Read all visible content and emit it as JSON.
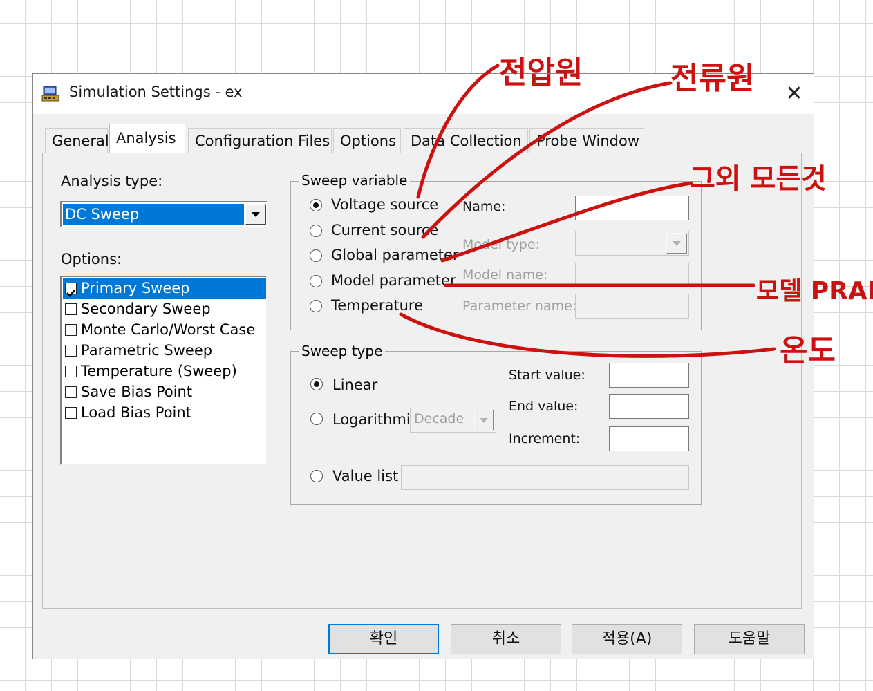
{
  "window": {
    "title": "Simulation Settings - ex",
    "close_glyph": "✕"
  },
  "tabs": [
    {
      "label": "General"
    },
    {
      "label": "Analysis",
      "active": true
    },
    {
      "label": "Configuration Files"
    },
    {
      "label": "Options"
    },
    {
      "label": "Data Collection"
    },
    {
      "label": "Probe Window"
    }
  ],
  "analysis": {
    "type_label": "Analysis type:",
    "type_value": "DC Sweep",
    "options_label": "Options:",
    "options": [
      {
        "label": "Primary Sweep",
        "checked": true,
        "selected": true
      },
      {
        "label": "Secondary Sweep",
        "checked": false
      },
      {
        "label": "Monte Carlo/Worst Case",
        "checked": false
      },
      {
        "label": "Parametric Sweep",
        "checked": false
      },
      {
        "label": "Temperature (Sweep)",
        "checked": false
      },
      {
        "label": "Save Bias Point",
        "checked": false
      },
      {
        "label": "Load Bias Point",
        "checked": false
      }
    ]
  },
  "sweep_variable": {
    "title": "Sweep variable",
    "radios": [
      {
        "label": "Voltage source",
        "selected": true
      },
      {
        "label": "Current source",
        "selected": false
      },
      {
        "label": "Global parameter",
        "selected": false
      },
      {
        "label": "Model parameter",
        "selected": false
      },
      {
        "label": "Temperature",
        "selected": false
      }
    ],
    "name_label": "Name:",
    "name_value": "",
    "model_type_label": "Model type:",
    "model_name_label": "Model name:",
    "parameter_name_label": "Parameter name:"
  },
  "sweep_type": {
    "title": "Sweep type",
    "linear_label": "Linear",
    "linear_selected": true,
    "log_label": "Logarithmic",
    "log_scale": "Decade",
    "start_label": "Start value:",
    "end_label": "End value:",
    "increment_label": "Increment:",
    "value_list_label": "Value list"
  },
  "buttons": {
    "ok": "확인",
    "cancel": "취소",
    "apply": "적용(A)",
    "help": "도움말"
  },
  "annotations": {
    "voltage": "전압원",
    "current": "전류원",
    "others": "그외 모든것",
    "model": "모델 PRAM",
    "temperature": "온도",
    "color": "#cc1111"
  }
}
